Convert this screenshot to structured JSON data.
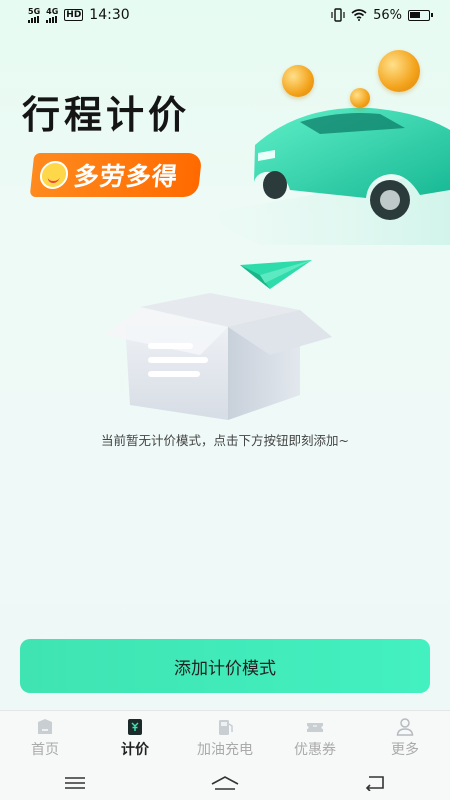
{
  "status_bar": {
    "signal_1": "5G",
    "signal_2": "4G",
    "hd_label": "HD",
    "time": "14:30",
    "battery": "56%"
  },
  "banner": {
    "title": "行程计价",
    "badge_text": "多劳多得"
  },
  "empty_state": {
    "message": "当前暂无计价模式，点击下方按钮即刻添加~"
  },
  "add_button": {
    "label": "添加计价模式"
  },
  "tabs": [
    {
      "label": "首页",
      "icon": "home-icon",
      "active": false
    },
    {
      "label": "计价",
      "icon": "pricing-icon",
      "active": true
    },
    {
      "label": "加油充电",
      "icon": "fuel-icon",
      "active": false
    },
    {
      "label": "优惠券",
      "icon": "coupon-icon",
      "active": false
    },
    {
      "label": "更多",
      "icon": "user-icon",
      "active": false
    }
  ],
  "colors": {
    "accent": "#43ecbb",
    "badge": "#ff7a10"
  }
}
